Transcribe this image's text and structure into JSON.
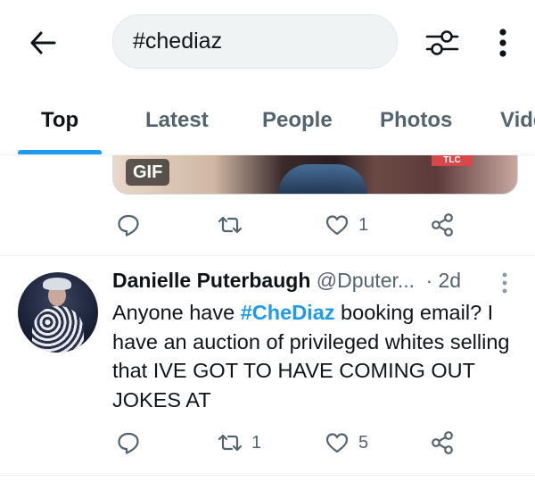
{
  "header": {
    "back_icon": "arrow-left-icon",
    "search_value": "#chediaz",
    "filter_icon": "sliders-icon",
    "more_icon": "vertical-dots-icon"
  },
  "tabs": [
    {
      "label": "Top",
      "active": true
    },
    {
      "label": "Latest",
      "active": false
    },
    {
      "label": "People",
      "active": false
    },
    {
      "label": "Photos",
      "active": false
    },
    {
      "label": "Videos",
      "active": false
    }
  ],
  "accent_color": "#1d9bf0",
  "tweets": [
    {
      "media_badge": "GIF",
      "media_logo": "TLC",
      "reply_count": "",
      "retweet_count": "",
      "like_count": "1"
    },
    {
      "name": "Danielle Puterbaugh",
      "handle": "@Dputer...",
      "separator": "·",
      "time": "2d",
      "text_before": "Anyone have ",
      "hashtag": "#CheDiaz",
      "text_after": " booking email? I have an auction of privileged whites selling that IVE GOT TO HAVE COMING OUT JOKES AT",
      "reply_count": "",
      "retweet_count": "1",
      "like_count": "5"
    }
  ]
}
